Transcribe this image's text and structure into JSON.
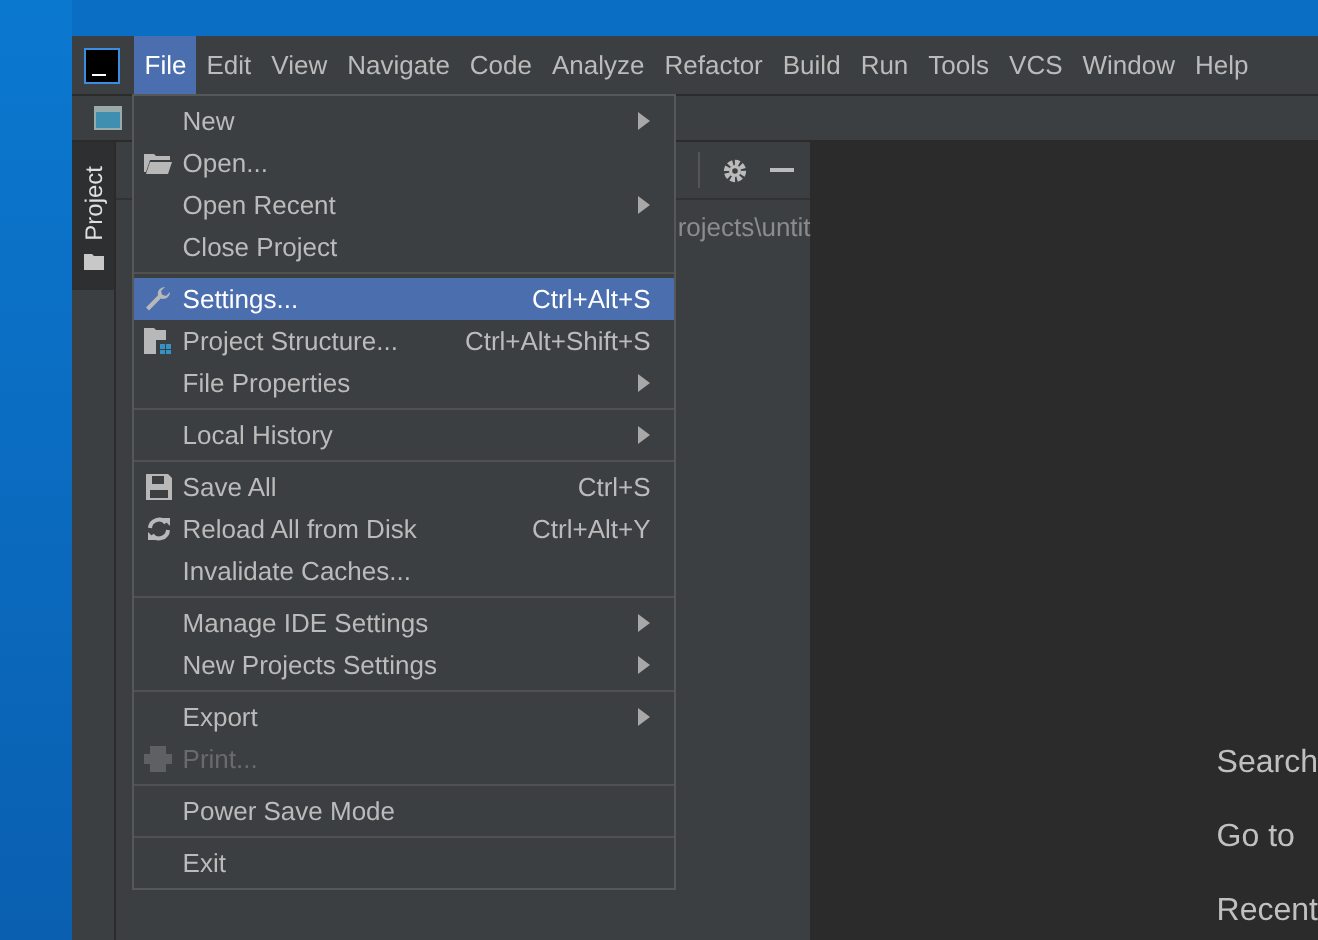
{
  "menubar": [
    {
      "label": "File",
      "selected": true
    },
    {
      "label": "Edit",
      "selected": false
    },
    {
      "label": "View",
      "selected": false
    },
    {
      "label": "Navigate",
      "selected": false
    },
    {
      "label": "Code",
      "selected": false
    },
    {
      "label": "Analyze",
      "selected": false
    },
    {
      "label": "Refactor",
      "selected": false
    },
    {
      "label": "Build",
      "selected": false
    },
    {
      "label": "Run",
      "selected": false
    },
    {
      "label": "Tools",
      "selected": false
    },
    {
      "label": "VCS",
      "selected": false
    },
    {
      "label": "Window",
      "selected": false
    },
    {
      "label": "Help",
      "selected": false
    }
  ],
  "tool_strip": {
    "project_tab": "Project"
  },
  "project_panel": {
    "path": "rojects\\untit"
  },
  "editor": {
    "hints": [
      "Search",
      "Go to",
      "Recent"
    ]
  },
  "file_menu": [
    [
      {
        "label": "New",
        "submenu": true,
        "selected": false,
        "disabled": false
      },
      {
        "label": "Open...",
        "submenu": false,
        "selected": false,
        "disabled": false
      },
      {
        "label": "Open Recent",
        "submenu": true,
        "selected": false,
        "disabled": false
      },
      {
        "label": "Close Project",
        "submenu": false,
        "selected": false,
        "disabled": false
      }
    ],
    [
      {
        "label": "Settings...",
        "shortcut": "Ctrl+Alt+S",
        "submenu": false,
        "selected": true,
        "disabled": false
      },
      {
        "label": "Project Structure...",
        "shortcut": "Ctrl+Alt+Shift+S",
        "submenu": false,
        "selected": false,
        "disabled": false
      },
      {
        "label": "File Properties",
        "submenu": true,
        "selected": false,
        "disabled": false
      }
    ],
    [
      {
        "label": "Local History",
        "submenu": true,
        "selected": false,
        "disabled": false
      }
    ],
    [
      {
        "label": "Save All",
        "shortcut": "Ctrl+S",
        "submenu": false,
        "selected": false,
        "disabled": false
      },
      {
        "label": "Reload All from Disk",
        "shortcut": "Ctrl+Alt+Y",
        "submenu": false,
        "selected": false,
        "disabled": false
      },
      {
        "label": "Invalidate Caches...",
        "submenu": false,
        "selected": false,
        "disabled": false
      }
    ],
    [
      {
        "label": "Manage IDE Settings",
        "submenu": true,
        "selected": false,
        "disabled": false
      },
      {
        "label": "New Projects Settings",
        "submenu": true,
        "selected": false,
        "disabled": false
      }
    ],
    [
      {
        "label": "Export",
        "submenu": true,
        "selected": false,
        "disabled": false
      },
      {
        "label": "Print...",
        "submenu": false,
        "selected": false,
        "disabled": true
      }
    ],
    [
      {
        "label": "Power Save Mode",
        "submenu": false,
        "selected": false,
        "disabled": false
      }
    ],
    [
      {
        "label": "Exit",
        "submenu": false,
        "selected": false,
        "disabled": false
      }
    ]
  ]
}
